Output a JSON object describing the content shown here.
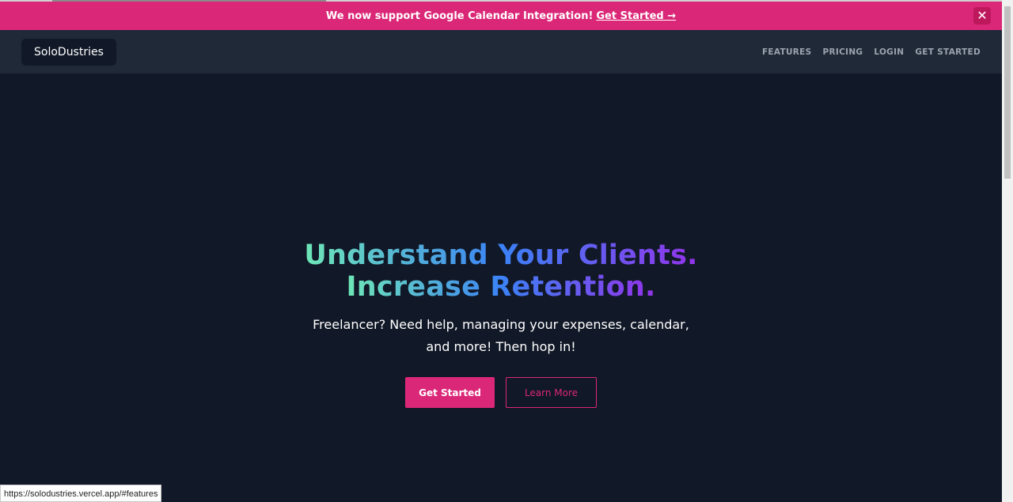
{
  "announcement": {
    "message": "We now support Google Calendar Integration!",
    "link": "Get Started →",
    "close_icon": "close-icon"
  },
  "nav": {
    "logo": "SoloDustries",
    "links": [
      "FEATURES",
      "PRICING",
      "LOGIN",
      "GET STARTED"
    ]
  },
  "hero": {
    "headline_line1": "Understand Your Clients.",
    "headline_line2": "Increase Retention.",
    "subtitle": "Freelancer? Need help, managing your expenses, calendar, and more! Then hop in!",
    "primary_button": "Get Started",
    "secondary_button": "Learn More"
  },
  "status_bar": {
    "url": "https://solodustries.vercel.app/#features"
  },
  "colors": {
    "accent": "#db2777",
    "background": "#111827",
    "navbar": "#1f2937",
    "gradient": [
      "#6ee7b7",
      "#3b82f6",
      "#9333ea"
    ]
  }
}
